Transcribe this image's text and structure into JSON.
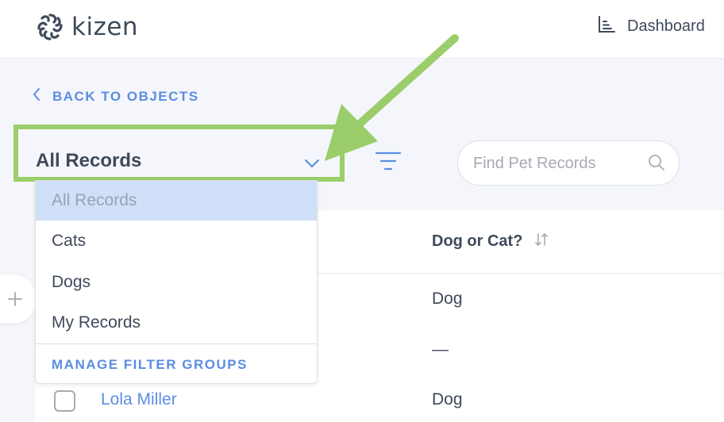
{
  "app": {
    "logo_text": "kizen",
    "dashboard_label": "Dashboard"
  },
  "nav": {
    "back_label": "BACK TO OBJECTS"
  },
  "filter_select": {
    "selected": "All Records",
    "options": [
      "All Records",
      "Cats",
      "Dogs",
      "My Records"
    ],
    "manage_label": "MANAGE FILTER GROUPS"
  },
  "search": {
    "placeholder": "Find Pet Records",
    "value": ""
  },
  "table": {
    "columns": [
      "Dog or Cat?"
    ],
    "rows": [
      {
        "name": "",
        "type": "Dog"
      },
      {
        "name": "",
        "type": "—"
      },
      {
        "name": "Lola Miller",
        "type": "Dog"
      }
    ]
  },
  "colors": {
    "accent_blue": "#5b8de3",
    "highlight_green": "#9bcd6a",
    "selected_option_bg": "#cfdff8",
    "text_dark": "#3f4a5a"
  },
  "icons": [
    "kizen-logo-icon",
    "dashboard-icon",
    "chevron-left-icon",
    "chevron-down-icon",
    "filter-icon",
    "search-icon",
    "sort-icon",
    "plus-icon"
  ]
}
